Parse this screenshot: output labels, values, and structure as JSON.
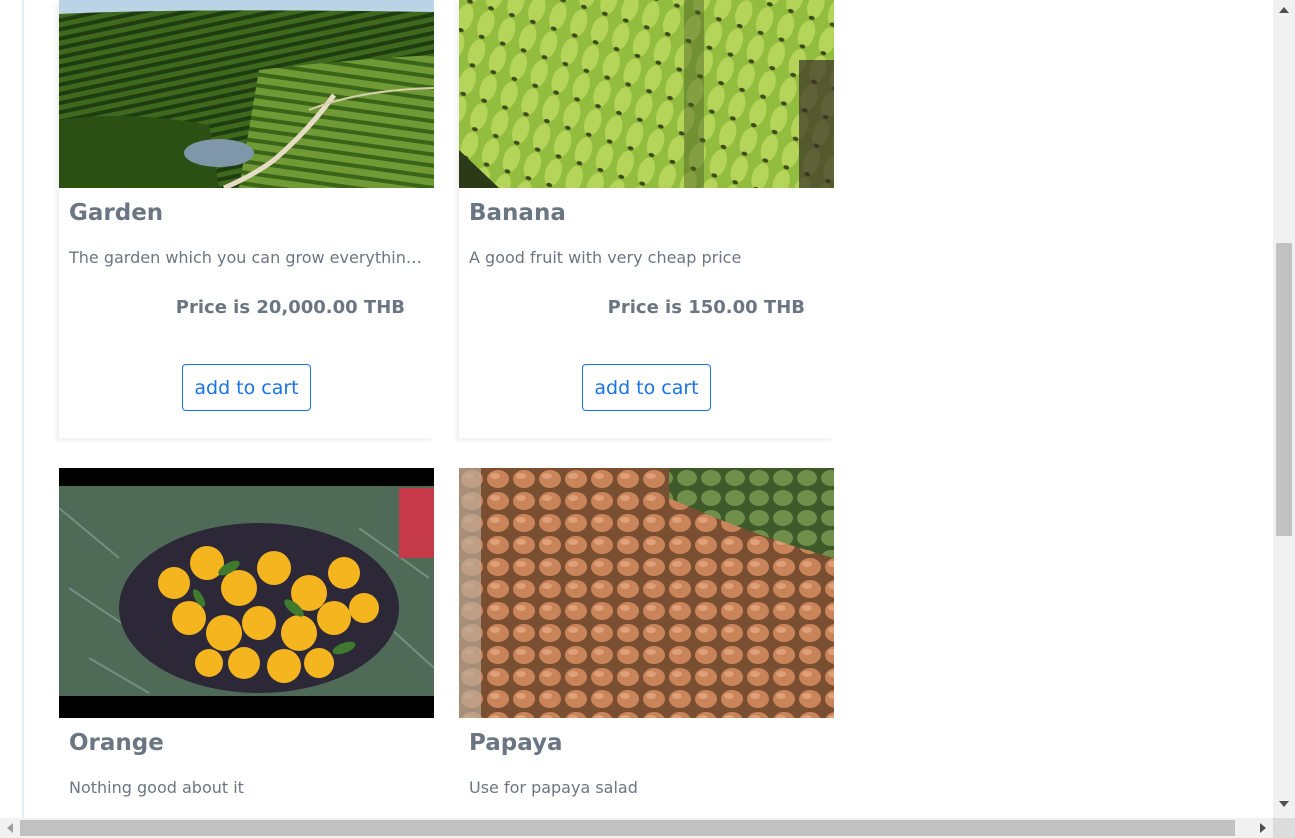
{
  "products": [
    {
      "name": "Garden",
      "description": "The garden which you can grow everything ...",
      "price": "Price is 20,000.00 THB",
      "button": "add to cart",
      "image": "garden-orchard-photo"
    },
    {
      "name": "Banana",
      "description": "A good fruit with very cheap price",
      "price": "Price is 150.00 THB",
      "button": "add to cart",
      "image": "banana-bunches-photo"
    },
    {
      "name": "Orange",
      "description": "Nothing good about it",
      "image": "oranges-basket-photo"
    },
    {
      "name": "Papaya",
      "description": "Use for papaya salad",
      "image": "papaya-pile-photo"
    }
  ],
  "scrollbars": {
    "vertical_thumb_position": 0.38,
    "horizontal_thumb_position": 0.0
  },
  "colors": {
    "text_muted": "#6b7682",
    "button_primary": "#1a73e8",
    "scroll_track": "#f1f1f1",
    "scroll_thumb": "#c1c1c1"
  }
}
